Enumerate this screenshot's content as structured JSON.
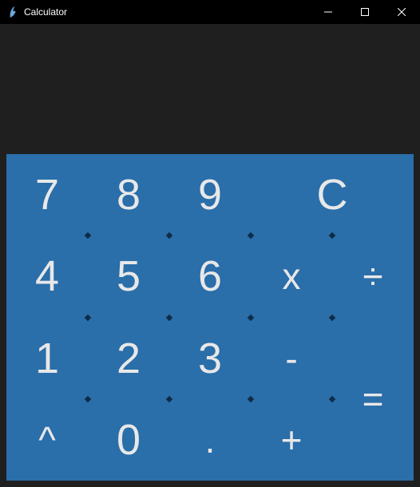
{
  "window": {
    "title": "Calculator",
    "icon": "feather-icon"
  },
  "controls": {
    "minimize": "minimize",
    "maximize": "maximize",
    "close": "close"
  },
  "display": {
    "value": ""
  },
  "buttons": {
    "seven": "7",
    "eight": "8",
    "nine": "9",
    "clear": "C",
    "four": "4",
    "five": "5",
    "six": "6",
    "multiply": "x",
    "divide": "÷",
    "one": "1",
    "two": "2",
    "three": "3",
    "minus": "-",
    "equals": "=",
    "power": "^",
    "zero": "0",
    "decimal": ".",
    "plus": "+"
  },
  "colors": {
    "button_bg": "#2a6eaa",
    "button_fg": "#e8e8e8",
    "window_bg": "#1f1f1f",
    "titlebar_bg": "#000000"
  }
}
